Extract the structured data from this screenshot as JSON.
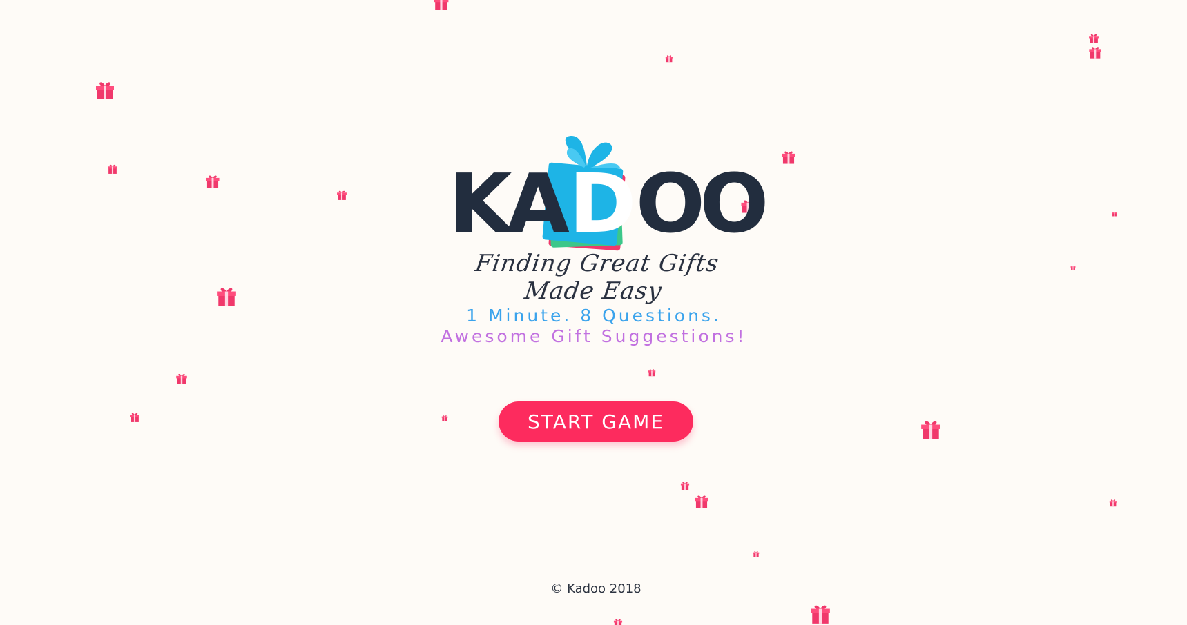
{
  "brand": {
    "logo_letters": [
      "K",
      "A",
      "D",
      "O",
      "O"
    ],
    "logo_box_letter_index": 2,
    "tagline": "Finding Great Gifts Made Easy"
  },
  "pitch": {
    "line1": "1 Minute. 8 Questions.",
    "line2": "Awesome Gift Suggestions!"
  },
  "actions": {
    "start_label": "START GAME"
  },
  "footer": {
    "copyright": "© Kadoo 2018"
  },
  "colors": {
    "background": "#fefbf7",
    "logo_dark": "#222d3e",
    "logo_box": "#1eb4e6",
    "accent_pink": "#fd2b5e",
    "pitch_blue": "#3aa3ec",
    "pitch_purple": "#c170e0"
  },
  "decoration_icon": "gift-icon"
}
